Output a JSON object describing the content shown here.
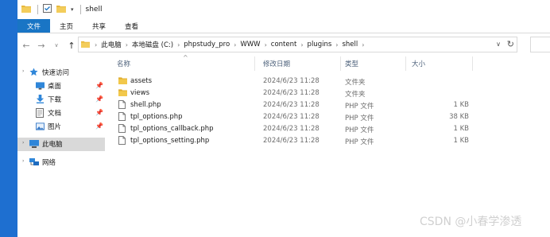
{
  "window": {
    "title": "shell"
  },
  "ribbon": {
    "tabs": [
      "文件",
      "主页",
      "共享",
      "查看"
    ]
  },
  "address": {
    "crumbs": [
      "此电脑",
      "本地磁盘 (C:)",
      "phpstudy_pro",
      "WWW",
      "content",
      "plugins",
      "shell"
    ]
  },
  "navigation": {
    "quick_access": "快速访问",
    "items": [
      {
        "label": "桌面",
        "icon": "desktop-icon",
        "pinned": true
      },
      {
        "label": "下载",
        "icon": "download-icon",
        "pinned": true
      },
      {
        "label": "文档",
        "icon": "document-icon",
        "pinned": true
      },
      {
        "label": "图片",
        "icon": "pictures-icon",
        "pinned": true
      }
    ],
    "this_pc": "此电脑",
    "network": "网络"
  },
  "columns": {
    "name": "名称",
    "modified": "修改日期",
    "type": "类型",
    "size": "大小"
  },
  "files": [
    {
      "name": "assets",
      "modified": "2024/6/23 11:28",
      "type": "文件夹",
      "size": "",
      "icon": "folder-icon"
    },
    {
      "name": "views",
      "modified": "2024/6/23 11:28",
      "type": "文件夹",
      "size": "",
      "icon": "folder-icon"
    },
    {
      "name": "shell.php",
      "modified": "2024/6/23 11:28",
      "type": "PHP 文件",
      "size": "1 KB",
      "icon": "php-file-icon"
    },
    {
      "name": "tpl_options.php",
      "modified": "2024/6/23 11:28",
      "type": "PHP 文件",
      "size": "38 KB",
      "icon": "php-file-icon"
    },
    {
      "name": "tpl_options_callback.php",
      "modified": "2024/6/23 11:28",
      "type": "PHP 文件",
      "size": "1 KB",
      "icon": "php-file-icon"
    },
    {
      "name": "tpl_options_setting.php",
      "modified": "2024/6/23 11:28",
      "type": "PHP 文件",
      "size": "1 KB",
      "icon": "php-file-icon"
    }
  ],
  "watermark": "CSDN @小春学渗透",
  "colors": {
    "accent": "#1975c5",
    "folder": "#e8b93e",
    "selection": "#d9d9d9",
    "header_text": "#4c607a"
  }
}
